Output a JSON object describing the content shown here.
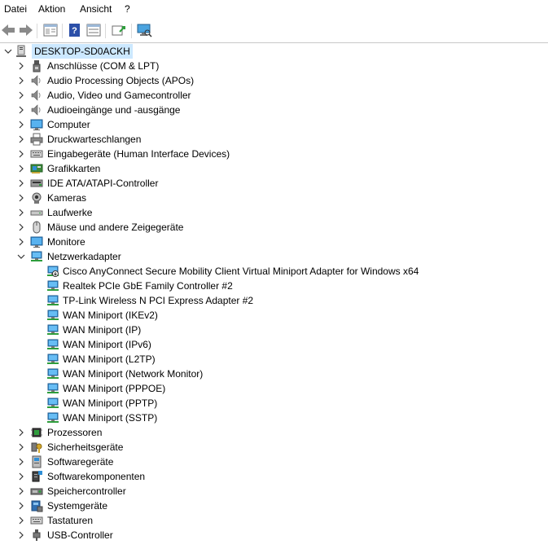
{
  "menu": {
    "items": [
      "Datei",
      "Aktion",
      "Ansicht",
      "?"
    ]
  },
  "toolbar": {
    "buttons": [
      "back-icon",
      "forward-icon",
      "properties-pane-icon",
      "help-icon",
      "view-icon",
      "update-driver-icon",
      "scan-hardware-icon"
    ]
  },
  "tree": {
    "root": "DESKTOP-SD0ACKH",
    "categories": [
      {
        "label": "Anschlüsse (COM & LPT)",
        "icon": "port-icon"
      },
      {
        "label": "Audio Processing Objects (APOs)",
        "icon": "speaker-icon"
      },
      {
        "label": "Audio, Video und Gamecontroller",
        "icon": "speaker-icon"
      },
      {
        "label": "Audioeingänge und -ausgänge",
        "icon": "speaker-icon"
      },
      {
        "label": "Computer",
        "icon": "monitor-icon"
      },
      {
        "label": "Druckwarteschlangen",
        "icon": "printer-icon"
      },
      {
        "label": "Eingabegeräte (Human Interface Devices)",
        "icon": "keyboard-icon"
      },
      {
        "label": "Grafikkarten",
        "icon": "display-adapter-icon"
      },
      {
        "label": "IDE ATA/ATAPI-Controller",
        "icon": "ide-icon"
      },
      {
        "label": "Kameras",
        "icon": "camera-icon"
      },
      {
        "label": "Laufwerke",
        "icon": "drive-icon"
      },
      {
        "label": "Mäuse und andere Zeigegeräte",
        "icon": "mouse-icon"
      },
      {
        "label": "Monitore",
        "icon": "monitor-icon"
      },
      {
        "label": "Netzwerkadapter",
        "icon": "network-icon"
      }
    ],
    "network_adapters": [
      "Cisco AnyConnect Secure Mobility Client Virtual Miniport Adapter for Windows x64",
      "Realtek PCIe GbE Family Controller #2",
      "TP-Link Wireless N PCI Express Adapter #2",
      "WAN Miniport (IKEv2)",
      "WAN Miniport (IP)",
      "WAN Miniport (IPv6)",
      "WAN Miniport (L2TP)",
      "WAN Miniport (Network Monitor)",
      "WAN Miniport (PPPOE)",
      "WAN Miniport (PPTP)",
      "WAN Miniport (SSTP)"
    ],
    "categories_after": [
      {
        "label": "Prozessoren",
        "icon": "processor-icon"
      },
      {
        "label": "Sicherheitsgeräte",
        "icon": "security-key-icon"
      },
      {
        "label": "Softwaregeräte",
        "icon": "software-device-icon"
      },
      {
        "label": "Softwarekomponenten",
        "icon": "software-component-icon"
      },
      {
        "label": "Speichercontroller",
        "icon": "storage-controller-icon"
      },
      {
        "label": "Systemgeräte",
        "icon": "system-device-icon"
      },
      {
        "label": "Tastaturen",
        "icon": "keyboard-icon"
      },
      {
        "label": "USB-Controller",
        "icon": "usb-icon"
      }
    ]
  }
}
